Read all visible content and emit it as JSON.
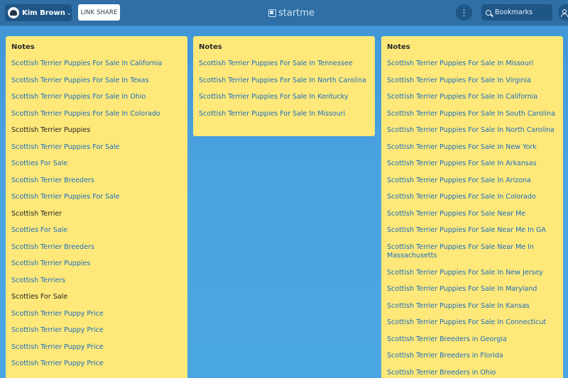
{
  "topbar": {
    "user_name": "Kim Brown",
    "link_share_label": "LINK SHARE",
    "logo_text": "startme",
    "search_label": "Bookmarks"
  },
  "widgets": [
    {
      "title": "Notes",
      "items": [
        {
          "text": "Scottish Terrier Puppies For Sale In California",
          "link": true
        },
        {
          "text": "Scottish Terrier Puppies For Sale In Texas",
          "link": true
        },
        {
          "text": "Scottish Terrier Puppies For Sale In Ohio",
          "link": true
        },
        {
          "text": "Scottish Terrier Puppies For Sale In Colorado",
          "link": true
        },
        {
          "text": "Scottish Terrier Puppies",
          "link": false
        },
        {
          "text": "Scottish Terrier Puppies For Sale",
          "link": true
        },
        {
          "text": "Scotties For Sale",
          "link": true
        },
        {
          "text": "Scottish Terrier Breeders",
          "link": true
        },
        {
          "text": "Scottish Terrier Puppies For Sale",
          "link": true
        },
        {
          "text": "Scottish Terrier",
          "link": false
        },
        {
          "text": "Scotties For Sale",
          "link": true
        },
        {
          "text": "Scottish Terrier Breeders",
          "link": true
        },
        {
          "text": "Scottish Terrier Puppies",
          "link": true
        },
        {
          "text": "Scottish Terriers",
          "link": true
        },
        {
          "text": "Scotties For Sale",
          "link": false
        },
        {
          "text": "Scottish Terrier Puppy Price",
          "link": true
        },
        {
          "text": "Scottish Terrier Puppy Price",
          "link": true
        },
        {
          "text": "Scottish Terrier Puppy Price",
          "link": true
        },
        {
          "text": "Scottish Terrier Puppy Price",
          "link": true
        }
      ]
    },
    {
      "title": "Notes",
      "items": [
        {
          "text": "Scottish Terrier Puppies For Sale In Tennessee",
          "link": true
        },
        {
          "text": "Scottish Terrier Puppies For Sale In North Carolina",
          "link": true
        },
        {
          "text": "Scottish Terrier Puppies For Sale In Kentucky",
          "link": true
        },
        {
          "text": "Scottish Terrier Puppies For Sale In Missouri",
          "link": true
        }
      ]
    },
    {
      "title": "Notes",
      "items": [
        {
          "text": "Scottish Terrier Puppies For Sale In Missouri",
          "link": true
        },
        {
          "text": "Scottish Terrier Puppies For Sale In Virginia",
          "link": true
        },
        {
          "text": "Scottish Terrier Puppies For Sale In California",
          "link": true
        },
        {
          "text": "Scottish Terrier Puppies For Sale In South Carolina",
          "link": true
        },
        {
          "text": "Scottish Terrier Puppies For Sale In North Carolina",
          "link": true
        },
        {
          "text": "Scottish Terrier Puppies For Sale In New York",
          "link": true
        },
        {
          "text": "Scottish Terrier Puppies For Sale In Arkansas",
          "link": true
        },
        {
          "text": "Scottish Terrier Puppies For Sale In Arizona",
          "link": true
        },
        {
          "text": "Scottish Terrier Puppies For Sale In Colorado",
          "link": true
        },
        {
          "text": "Scottish Terrier Puppies For Sale Near Me",
          "link": true
        },
        {
          "text": "Scottish Terrier Puppies For Sale Near Me In GA",
          "link": true
        },
        {
          "text": "Scottish Terrier Puppies For Sale Near Me In Massachusetts",
          "link": true
        },
        {
          "text": "Scottish Terrier Puppies For Sale In New Jersey",
          "link": true
        },
        {
          "text": "Scottish Terrier Puppies For Sale In Maryland",
          "link": true
        },
        {
          "text": "Scottish Terrier Puppies For Sale In Kansas",
          "link": true
        },
        {
          "text": "Scottish Terrier Puppies For Sale In Connecticut",
          "link": true
        },
        {
          "text": "Scottish Terrier Breeders in Georgia",
          "link": true
        },
        {
          "text": "Scottish Terrier Breeders in Florida",
          "link": true
        },
        {
          "text": "Scottish Terrier Breeders in Ohio",
          "link": true
        }
      ]
    }
  ]
}
